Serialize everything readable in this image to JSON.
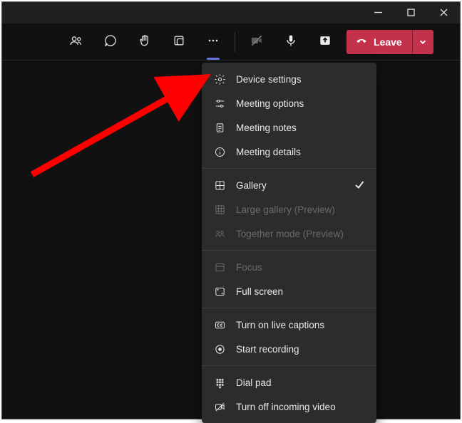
{
  "leave_button": {
    "label": "Leave"
  },
  "menu": {
    "items": [
      {
        "label": "Device settings"
      },
      {
        "label": "Meeting options"
      },
      {
        "label": "Meeting notes"
      },
      {
        "label": "Meeting details"
      },
      {
        "label": "Gallery"
      },
      {
        "label": "Large gallery (Preview)"
      },
      {
        "label": "Together mode (Preview)"
      },
      {
        "label": "Focus"
      },
      {
        "label": "Full screen"
      },
      {
        "label": "Turn on live captions"
      },
      {
        "label": "Start recording"
      },
      {
        "label": "Dial pad"
      },
      {
        "label": "Turn off incoming video"
      }
    ]
  }
}
